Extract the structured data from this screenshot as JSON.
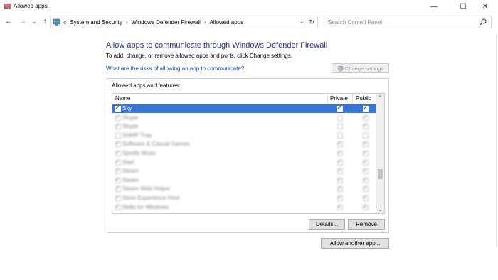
{
  "window": {
    "title": "Allowed apps",
    "controls": {
      "minimize": "—",
      "maximize": "☐",
      "close": "✕"
    }
  },
  "nav": {
    "back": "←",
    "forward": "→",
    "recent": "⌄",
    "up": "↑",
    "breadcrumb_overflow": "«",
    "breadcrumbs": [
      "System and Security",
      "Windows Defender Firewall",
      "Allowed apps"
    ],
    "separator": "›",
    "dropdown": "⌄",
    "refresh": "↻",
    "search_placeholder": "Search Control Panel"
  },
  "main": {
    "heading": "Allow apps to communicate through Windows Defender Firewall",
    "subtext": "To add, change, or remove allowed apps and ports, click Change settings.",
    "risk_link": "What are the risks of allowing an app to communicate?",
    "change_settings": "Change settings",
    "group_label": "Allowed apps and features:",
    "columns": {
      "name": "Name",
      "private": "Private",
      "public": "Public"
    },
    "rows": [
      {
        "name": "Sky",
        "enabled": true,
        "private": true,
        "public": true,
        "selected": true,
        "legible": true
      },
      {
        "name": "Skype",
        "enabled": true,
        "private": false,
        "public": true,
        "selected": false,
        "legible": false
      },
      {
        "name": "Skype",
        "enabled": true,
        "private": false,
        "public": true,
        "selected": false,
        "legible": false
      },
      {
        "name": "SNMP Trap",
        "enabled": false,
        "private": false,
        "public": false,
        "selected": false,
        "legible": false
      },
      {
        "name": "Software & Casual Games",
        "enabled": true,
        "private": true,
        "public": true,
        "selected": false,
        "legible": false
      },
      {
        "name": "Spotify Music",
        "enabled": true,
        "private": true,
        "public": true,
        "selected": false,
        "legible": false
      },
      {
        "name": "Start",
        "enabled": true,
        "private": true,
        "public": true,
        "selected": false,
        "legible": false
      },
      {
        "name": "Steam",
        "enabled": true,
        "private": true,
        "public": true,
        "selected": false,
        "legible": false
      },
      {
        "name": "Steam",
        "enabled": true,
        "private": true,
        "public": true,
        "selected": false,
        "legible": false
      },
      {
        "name": "Steam Web Helper",
        "enabled": true,
        "private": true,
        "public": true,
        "selected": false,
        "legible": false
      },
      {
        "name": "Store Experience Host",
        "enabled": true,
        "private": true,
        "public": true,
        "selected": false,
        "legible": false
      },
      {
        "name": "Skills for Windows",
        "enabled": true,
        "private": true,
        "public": true,
        "selected": false,
        "legible": false
      }
    ],
    "details_button": "Details...",
    "remove_button": "Remove",
    "allow_another_button": "Allow another app..."
  },
  "colors": {
    "heading": "#1e3287",
    "link": "#0645ad",
    "selection": "#3576d8"
  }
}
